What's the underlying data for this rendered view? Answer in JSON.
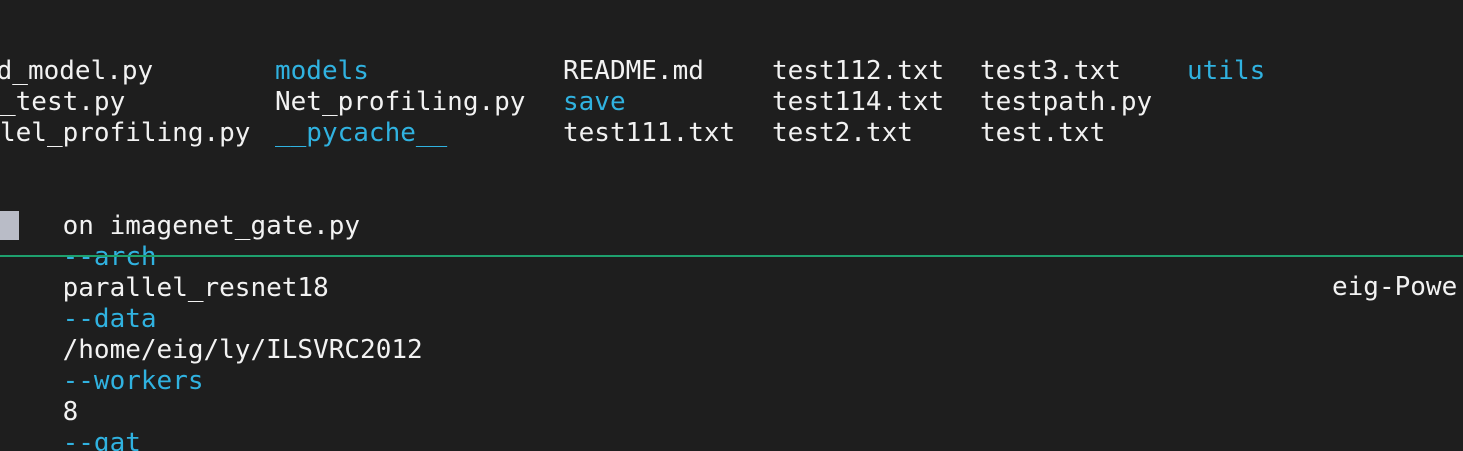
{
  "listing": {
    "col1": [
      "ad_model.py",
      "_test.py",
      "lel_profiling.py"
    ],
    "col2": [
      "models",
      "Net_profiling.py",
      "__pycache__"
    ],
    "col3": [
      "README.md",
      "save",
      "test111.txt"
    ],
    "col4": [
      "test112.txt",
      "test114.txt",
      "test2.txt"
    ],
    "col5": [
      "test3.txt",
      "testpath.py",
      "test.txt"
    ],
    "col6": [
      "utils"
    ]
  },
  "command": {
    "prefix": "on imagenet_gate.py",
    "arch_flag": "--arch",
    "arch_value": "parallel_resnet18",
    "data_flag": "--data",
    "data_value": "/home/eig/ly/ILSVRC2012",
    "workers_flag": "--workers",
    "workers_value": "8",
    "gate_flag": "--gat"
  },
  "status_bar": {
    "host": "eig-Powe"
  },
  "colors": {
    "background": "#1e1e1e",
    "text": "#f2f2f2",
    "directory": "#30b2e0",
    "option": "#30b2e0",
    "divider": "#1ea06e"
  }
}
